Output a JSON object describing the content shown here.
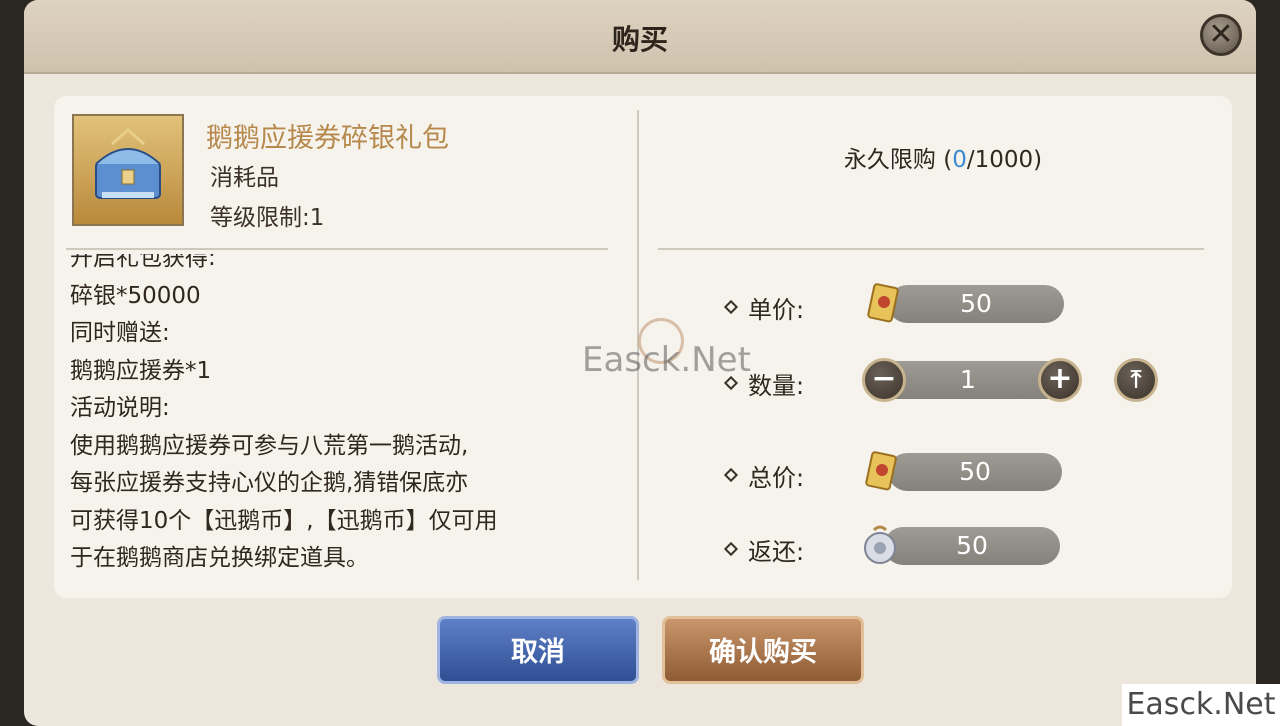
{
  "dialog": {
    "title": "购买",
    "close_label": "✕"
  },
  "item": {
    "name": "鹅鹅应援券碎银礼包",
    "type": "消耗品",
    "level_limit": "等级限制:1"
  },
  "description_lines": [
    "开启礼包获得:",
    "碎银*50000",
    "同时赠送:",
    "鹅鹅应援券*1",
    "活动说明:",
    "使用鹅鹅应援券可参与八荒第一鹅活动,",
    "每张应援券支持心仪的企鹅,猜错保底亦",
    "可获得10个【迅鹅币】,【迅鹅币】仅可用",
    "于在鹅鹅商店兑换绑定道具。"
  ],
  "purchase_limit": {
    "prefix": "永久限购 (",
    "current": "0",
    "suffix": "/1000)"
  },
  "unit_price": {
    "label": "单价:",
    "value": "50"
  },
  "quantity": {
    "label": "数量:",
    "value": "1",
    "minus": "−",
    "plus": "+",
    "max": "⤒"
  },
  "total_price": {
    "label": "总价:",
    "value": "50"
  },
  "refund": {
    "label": "返还:",
    "value": "50"
  },
  "buttons": {
    "cancel": "取消",
    "confirm": "确认购买"
  },
  "watermark": "Easck.Net",
  "corner_watermark": "Easck.Net",
  "colors": {
    "item_name": "#b6884b",
    "limit_current": "#3b8ad0",
    "cancel_button": "#3f5ea8",
    "confirm_button": "#a56d42"
  }
}
